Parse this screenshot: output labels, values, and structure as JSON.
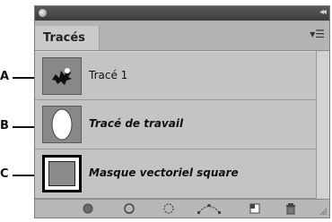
{
  "callouts": [
    "A",
    "B",
    "C"
  ],
  "panel": {
    "tab_label": "Tracés",
    "menu_icon": "panel-menu-icon",
    "rows": [
      {
        "label": "Tracé 1",
        "style": "normal",
        "thumbnail": "path-shape-thumbnail"
      },
      {
        "label": "Tracé de travail",
        "style": "italic",
        "thumbnail": "work-path-thumbnail"
      },
      {
        "label": "Masque vectoriel square",
        "style": "italic",
        "thumbnail": "vector-mask-thumbnail"
      }
    ],
    "bottom_icons": [
      "fill-path-icon",
      "stroke-path-icon",
      "load-as-selection-icon",
      "make-work-path-icon",
      "new-path-icon",
      "delete-path-icon"
    ]
  },
  "colors": {
    "panel_bg": "#c4c4c4",
    "titlebar": "#4a4a4a",
    "thumbnail_bg": "#888888"
  }
}
